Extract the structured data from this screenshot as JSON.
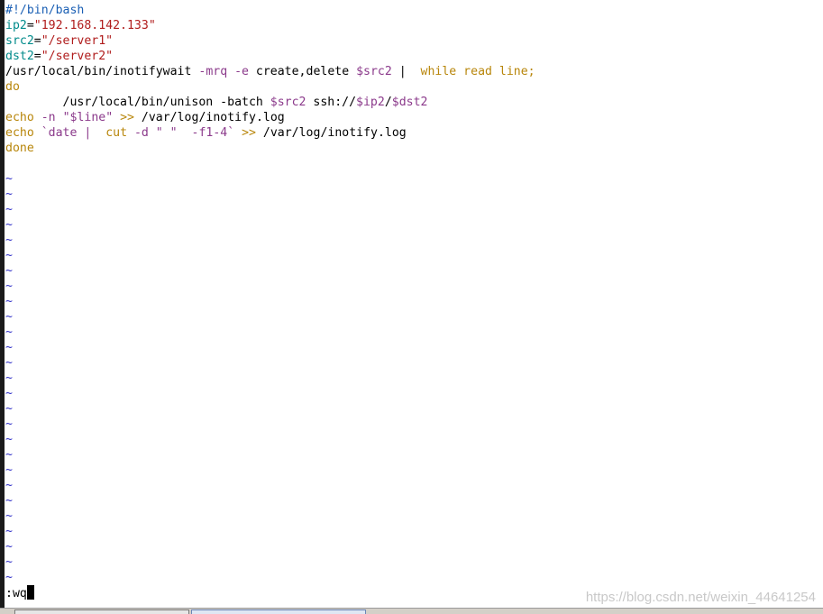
{
  "script_lines": [
    [
      {
        "t": "#!/bin/bash",
        "c": "comment"
      }
    ],
    [
      {
        "t": "ip2",
        "c": "ident"
      },
      {
        "t": "=",
        "c": "default"
      },
      {
        "t": "\"192.168.142.133\"",
        "c": "string"
      }
    ],
    [
      {
        "t": "src2",
        "c": "ident"
      },
      {
        "t": "=",
        "c": "default"
      },
      {
        "t": "\"/server1\"",
        "c": "string"
      }
    ],
    [
      {
        "t": "dst2",
        "c": "ident"
      },
      {
        "t": "=",
        "c": "default"
      },
      {
        "t": "\"/server2\"",
        "c": "string"
      }
    ],
    [
      {
        "t": "/usr/local/bin/inotifywait ",
        "c": "default"
      },
      {
        "t": "-mrq",
        "c": "option"
      },
      {
        "t": " ",
        "c": "default"
      },
      {
        "t": "-e",
        "c": "option"
      },
      {
        "t": " create,delete ",
        "c": "default"
      },
      {
        "t": "$src2",
        "c": "var"
      },
      {
        "t": " | ",
        "c": "default"
      },
      {
        "t": " while read line;",
        "c": "keyword"
      }
    ],
    [
      {
        "t": "do",
        "c": "keyword"
      }
    ],
    [
      {
        "t": "        /usr/local/bin/unison -batch ",
        "c": "default"
      },
      {
        "t": "$src2",
        "c": "var"
      },
      {
        "t": " ssh://",
        "c": "default"
      },
      {
        "t": "$ip2",
        "c": "var"
      },
      {
        "t": "/",
        "c": "default"
      },
      {
        "t": "$dst2",
        "c": "var"
      }
    ],
    [
      {
        "t": "echo",
        "c": "keyword"
      },
      {
        "t": " ",
        "c": "default"
      },
      {
        "t": "-n",
        "c": "option"
      },
      {
        "t": " ",
        "c": "default"
      },
      {
        "t": "\"$line\"",
        "c": "var"
      },
      {
        "t": " ",
        "c": "default"
      },
      {
        "t": ">>",
        "c": "keyword"
      },
      {
        "t": " /var/log/inotify.log",
        "c": "default"
      }
    ],
    [
      {
        "t": "echo",
        "c": "keyword"
      },
      {
        "t": " ",
        "c": "default"
      },
      {
        "t": "`date | ",
        "c": "var"
      },
      {
        "t": " cut",
        "c": "keyword"
      },
      {
        "t": " ",
        "c": "default"
      },
      {
        "t": "-d",
        "c": "option"
      },
      {
        "t": " \" \" ",
        "c": "var"
      },
      {
        "t": " -f1-4`",
        "c": "var"
      },
      {
        "t": " ",
        "c": "default"
      },
      {
        "t": ">>",
        "c": "keyword"
      },
      {
        "t": " /var/log/inotify.log",
        "c": "default"
      }
    ],
    [
      {
        "t": "done",
        "c": "keyword"
      }
    ]
  ],
  "empty_line_marker": "~",
  "empty_line_count": 27,
  "command_line": ":wq",
  "watermark": "https://blog.csdn.net/weixin_44641254",
  "colors": {
    "comment": "#1a5fb4",
    "string": "#b01c1c",
    "ident": "#008b8b",
    "keyword": "#b8860b",
    "var": "#8b3a8b",
    "tilde": "#3232c8"
  }
}
